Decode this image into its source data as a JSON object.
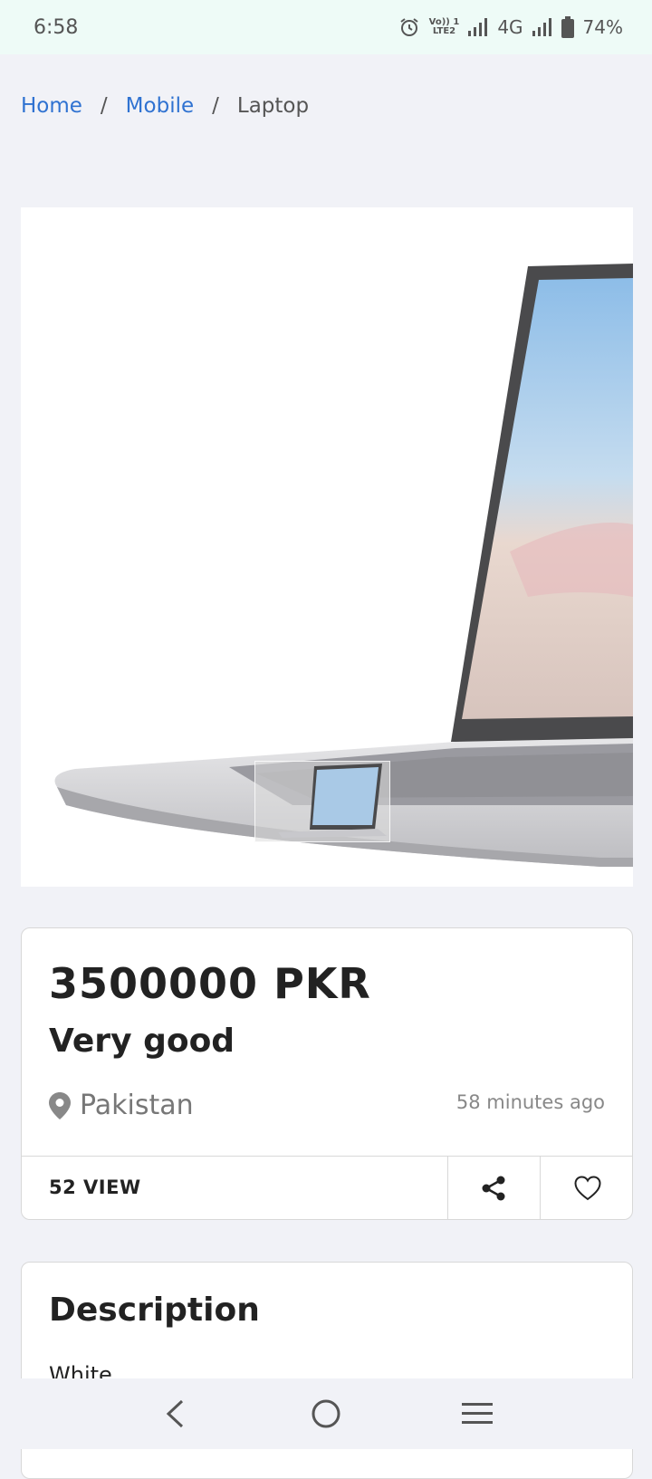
{
  "status": {
    "time": "6:58",
    "lte_top": "Vo)) 1",
    "lte_bottom": "LTE2",
    "network": "4G",
    "battery": "74%"
  },
  "breadcrumb": {
    "home": "Home",
    "category": "Mobile",
    "current": "Laptop",
    "separator": "/"
  },
  "listing": {
    "price": "3500000 PKR",
    "condition": "Very good",
    "location": "Pakistan",
    "posted": "58 minutes ago",
    "views": "52 VIEW"
  },
  "description": {
    "title": "Description",
    "text": "White"
  },
  "colors": {
    "accent_link": "#2f72d1",
    "page_bg": "#f1f2f7",
    "status_bg": "#eefbf7"
  },
  "icons": {
    "alarm": "alarm-icon",
    "signal": "signal-icon",
    "battery": "battery-icon",
    "location": "location-pin-icon",
    "share": "share-icon",
    "favorite": "heart-icon",
    "back": "back-icon",
    "home": "home-circle-icon",
    "menu": "menu-icon"
  }
}
